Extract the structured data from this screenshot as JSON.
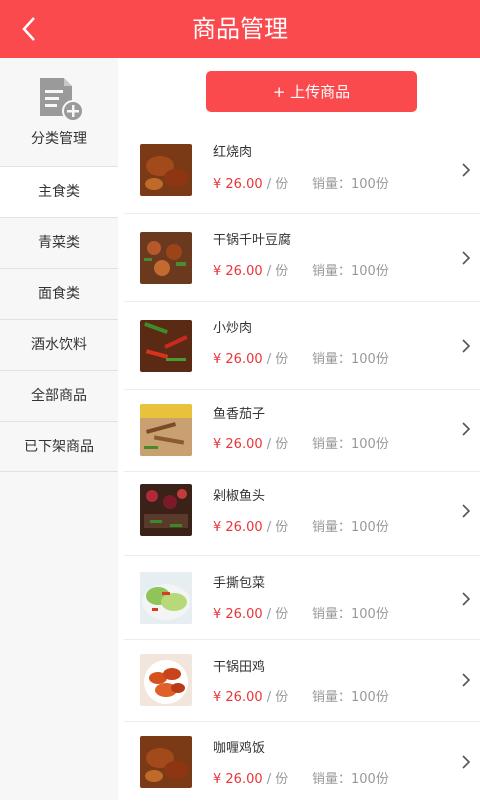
{
  "header": {
    "title": "商品管理",
    "back_icon": "chevron-left-icon"
  },
  "sidebar": {
    "manage": {
      "label": "分类管理",
      "icon": "document-add-icon"
    },
    "items": [
      {
        "label": "主食类",
        "active": true
      },
      {
        "label": "青菜类",
        "active": false
      },
      {
        "label": "面食类",
        "active": false
      },
      {
        "label": "酒水饮料",
        "active": false
      },
      {
        "label": "全部商品",
        "active": false
      },
      {
        "label": "已下架商品",
        "active": false
      }
    ]
  },
  "main": {
    "upload_label": "+ 上传商品",
    "products": [
      {
        "name": "红烧肉",
        "price": "¥ 26.00",
        "unit": "/ 份",
        "sales": "销量：100份"
      },
      {
        "name": "干锅千叶豆腐",
        "price": "¥ 26.00",
        "unit": "/ 份",
        "sales": "销量：100份"
      },
      {
        "name": "小炒肉",
        "price": "¥ 26.00",
        "unit": "/ 份",
        "sales": "销量：100份"
      },
      {
        "name": "鱼香茄子",
        "price": "¥ 26.00",
        "unit": "/ 份",
        "sales": "销量：100份"
      },
      {
        "name": "剁椒鱼头",
        "price": "¥ 26.00",
        "unit": "/ 份",
        "sales": "销量：100份"
      },
      {
        "name": "手撕包菜",
        "price": "¥ 26.00",
        "unit": "/ 份",
        "sales": "销量：100份"
      },
      {
        "name": "干锅田鸡",
        "price": "¥ 26.00",
        "unit": "/ 份",
        "sales": "销量：100份"
      },
      {
        "name": "咖喱鸡饭",
        "price": "¥ 26.00",
        "unit": "/ 份",
        "sales": "销量：100份"
      }
    ]
  },
  "colors": {
    "accent": "#fa4a4e",
    "price": "#e8353a",
    "sidebar_bg": "#f7f7f7"
  }
}
